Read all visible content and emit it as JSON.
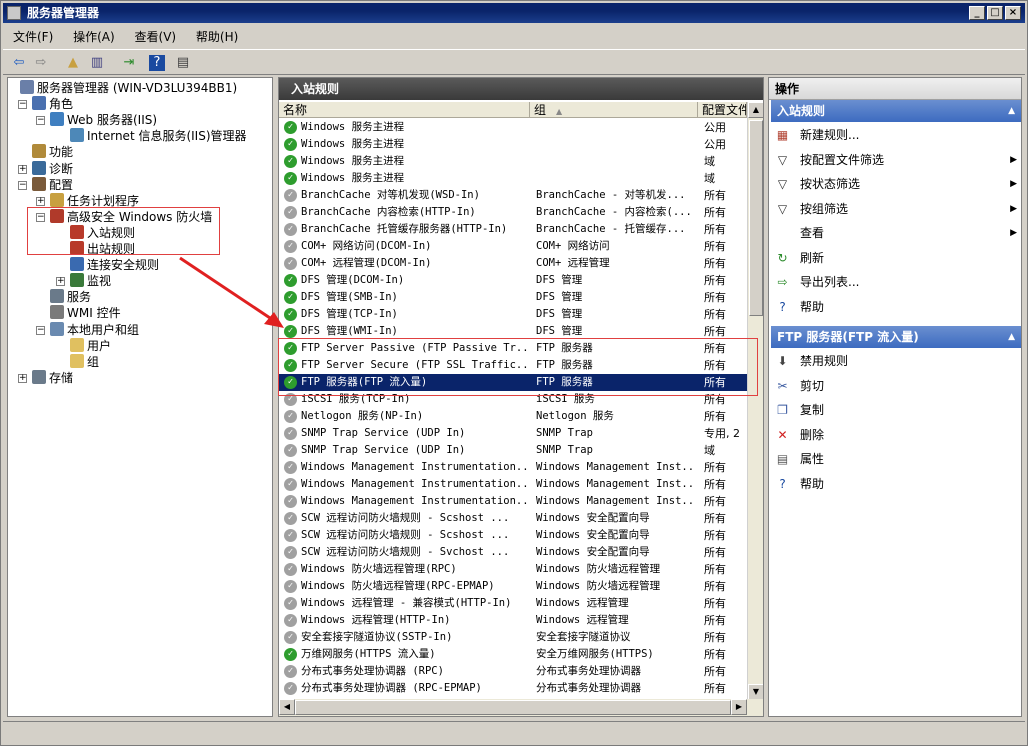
{
  "window": {
    "title": "服务器管理器"
  },
  "menu": [
    "文件(F)",
    "操作(A)",
    "查看(V)",
    "帮助(H)"
  ],
  "tree": [
    {
      "label": "服务器管理器 (WIN-VD3LU394BB1)",
      "level": 0,
      "expander": "",
      "color": "#6a7fa8"
    },
    {
      "label": "角色",
      "level": 1,
      "expander": "−",
      "color": "#4a70b0"
    },
    {
      "label": "Web 服务器(IIS)",
      "level": 2,
      "expander": "−",
      "color": "#3f7fc0"
    },
    {
      "label": "Internet 信息服务(IIS)管理器",
      "level": 3,
      "expander": "",
      "color": "#4d88b8"
    },
    {
      "label": "功能",
      "level": 1,
      "expander": "",
      "color": "#b08a3a"
    },
    {
      "label": "诊断",
      "level": 1,
      "expander": "+",
      "color": "#3a6a9a"
    },
    {
      "label": "配置",
      "level": 1,
      "expander": "−",
      "color": "#7a5a3a"
    },
    {
      "label": "任务计划程序",
      "level": 2,
      "expander": "+",
      "color": "#c8a040"
    },
    {
      "label": "高级安全 Windows 防火墙",
      "level": 2,
      "expander": "−",
      "color": "#b03a2a"
    },
    {
      "label": "入站规则",
      "level": 3,
      "expander": "",
      "color": "#b83a2a"
    },
    {
      "label": "出站规则",
      "level": 3,
      "expander": "",
      "color": "#b83a2a"
    },
    {
      "label": "连接安全规则",
      "level": 3,
      "expander": "",
      "color": "#3a6ab0"
    },
    {
      "label": "监视",
      "level": 3,
      "expander": "+",
      "color": "#3a7a3a"
    },
    {
      "label": "服务",
      "level": 2,
      "expander": "",
      "color": "#6a7a8a"
    },
    {
      "label": "WMI 控件",
      "level": 2,
      "expander": "",
      "color": "#7a7a7a"
    },
    {
      "label": "本地用户和组",
      "level": 2,
      "expander": "−",
      "color": "#6a8ab0"
    },
    {
      "label": "用户",
      "level": 3,
      "expander": "",
      "color": "#e0c060"
    },
    {
      "label": "组",
      "level": 3,
      "expander": "",
      "color": "#e0c060"
    },
    {
      "label": "存储",
      "level": 1,
      "expander": "+",
      "color": "#6a7a8a"
    }
  ],
  "center": {
    "title": "入站规则",
    "columns": [
      "名称",
      "组",
      "配置文件"
    ],
    "sort_indicator": "▲",
    "rows": [
      {
        "name": "Windows 服务主进程",
        "group": "",
        "profile": "公用",
        "enabled": true
      },
      {
        "name": "Windows 服务主进程",
        "group": "",
        "profile": "公用",
        "enabled": true
      },
      {
        "name": "Windows 服务主进程",
        "group": "",
        "profile": "域",
        "enabled": true
      },
      {
        "name": "Windows 服务主进程",
        "group": "",
        "profile": "域",
        "enabled": true
      },
      {
        "name": "BranchCache 对等机发现(WSD-In)",
        "group": "BranchCache - 对等机发...",
        "profile": "所有",
        "enabled": false
      },
      {
        "name": "BranchCache 内容检索(HTTP-In)",
        "group": "BranchCache - 内容检索(...",
        "profile": "所有",
        "enabled": false
      },
      {
        "name": "BranchCache 托管缓存服务器(HTTP-In)",
        "group": "BranchCache - 托管缓存...",
        "profile": "所有",
        "enabled": false
      },
      {
        "name": "COM+ 网络访问(DCOM-In)",
        "group": "COM+ 网络访问",
        "profile": "所有",
        "enabled": false
      },
      {
        "name": "COM+ 远程管理(DCOM-In)",
        "group": "COM+ 远程管理",
        "profile": "所有",
        "enabled": false
      },
      {
        "name": "DFS 管理(DCOM-In)",
        "group": "DFS 管理",
        "profile": "所有",
        "enabled": true
      },
      {
        "name": "DFS 管理(SMB-In)",
        "group": "DFS 管理",
        "profile": "所有",
        "enabled": true
      },
      {
        "name": "DFS 管理(TCP-In)",
        "group": "DFS 管理",
        "profile": "所有",
        "enabled": true
      },
      {
        "name": "DFS 管理(WMI-In)",
        "group": "DFS 管理",
        "profile": "所有",
        "enabled": true
      },
      {
        "name": "FTP Server Passive (FTP Passive Tr...",
        "group": "FTP 服务器",
        "profile": "所有",
        "enabled": true
      },
      {
        "name": "FTP Server Secure (FTP SSL Traffic...",
        "group": "FTP 服务器",
        "profile": "所有",
        "enabled": true
      },
      {
        "name": "FTP 服务器(FTP 流入量)",
        "group": "FTP 服务器",
        "profile": "所有",
        "enabled": true,
        "selected": true
      },
      {
        "name": "iSCSI 服务(TCP-In)",
        "group": "iSCSI 服务",
        "profile": "所有",
        "enabled": false
      },
      {
        "name": "Netlogon 服务(NP-In)",
        "group": "Netlogon 服务",
        "profile": "所有",
        "enabled": false
      },
      {
        "name": "SNMP Trap Service (UDP In)",
        "group": "SNMP Trap",
        "profile": "专用, 2",
        "enabled": false
      },
      {
        "name": "SNMP Trap Service (UDP In)",
        "group": "SNMP Trap",
        "profile": "域",
        "enabled": false
      },
      {
        "name": "Windows Management Instrumentation...",
        "group": "Windows Management Inst...",
        "profile": "所有",
        "enabled": false
      },
      {
        "name": "Windows Management Instrumentation...",
        "group": "Windows Management Inst...",
        "profile": "所有",
        "enabled": false
      },
      {
        "name": "Windows Management Instrumentation...",
        "group": "Windows Management Inst...",
        "profile": "所有",
        "enabled": false
      },
      {
        "name": "SCW 远程访问防火墙规则 - Scshost ...",
        "group": "Windows 安全配置向导",
        "profile": "所有",
        "enabled": false
      },
      {
        "name": "SCW 远程访问防火墙规则 - Scshost ...",
        "group": "Windows 安全配置向导",
        "profile": "所有",
        "enabled": false
      },
      {
        "name": "SCW 远程访问防火墙规则 - Svchost ...",
        "group": "Windows 安全配置向导",
        "profile": "所有",
        "enabled": false
      },
      {
        "name": "Windows 防火墙远程管理(RPC)",
        "group": "Windows 防火墙远程管理",
        "profile": "所有",
        "enabled": false
      },
      {
        "name": "Windows 防火墙远程管理(RPC-EPMAP)",
        "group": "Windows 防火墙远程管理",
        "profile": "所有",
        "enabled": false
      },
      {
        "name": "Windows 远程管理 - 兼容模式(HTTP-In)",
        "group": "Windows 远程管理",
        "profile": "所有",
        "enabled": false
      },
      {
        "name": "Windows 远程管理(HTTP-In)",
        "group": "Windows 远程管理",
        "profile": "所有",
        "enabled": false
      },
      {
        "name": "安全套接字隧道协议(SSTP-In)",
        "group": "安全套接字隧道协议",
        "profile": "所有",
        "enabled": false
      },
      {
        "name": "万维网服务(HTTPS 流入量)",
        "group": "安全万维网服务(HTTPS)",
        "profile": "所有",
        "enabled": true
      },
      {
        "name": "分布式事务处理协调器 (RPC)",
        "group": "分布式事务处理协调器",
        "profile": "所有",
        "enabled": false
      },
      {
        "name": "分布式事务处理协调器 (RPC-EPMAP)",
        "group": "分布式事务处理协调器",
        "profile": "所有",
        "enabled": false
      }
    ]
  },
  "actions": {
    "title": "操作",
    "section1": {
      "title": "入站规则",
      "items": [
        {
          "label": "新建规则...",
          "icon": "new-rule-icon",
          "glyph": "▦",
          "color": "#b04030",
          "submenu": false
        },
        {
          "label": "按配置文件筛选",
          "icon": "filter-icon",
          "glyph": "▽",
          "color": "#333333",
          "submenu": true
        },
        {
          "label": "按状态筛选",
          "icon": "filter-icon",
          "glyph": "▽",
          "color": "#333333",
          "submenu": true
        },
        {
          "label": "按组筛选",
          "icon": "filter-icon",
          "glyph": "▽",
          "color": "#333333",
          "submenu": true
        },
        {
          "label": "查看",
          "icon": "",
          "glyph": "",
          "color": "#333333",
          "submenu": true
        },
        {
          "label": "刷新",
          "icon": "refresh-icon",
          "glyph": "↻",
          "color": "#2a8a2a",
          "submenu": false
        },
        {
          "label": "导出列表...",
          "icon": "export-icon",
          "glyph": "⇨",
          "color": "#2a8a2a",
          "submenu": false
        },
        {
          "label": "帮助",
          "icon": "help-icon",
          "glyph": "?",
          "color": "#1a4aa0",
          "submenu": false
        }
      ]
    },
    "section2": {
      "title": "FTP 服务器(FTP 流入量)",
      "items": [
        {
          "label": "禁用规则",
          "icon": "disable-rule-icon",
          "glyph": "⬇",
          "color": "#444444"
        },
        {
          "label": "剪切",
          "icon": "cut-icon",
          "glyph": "✂",
          "color": "#3a5aa0"
        },
        {
          "label": "复制",
          "icon": "copy-icon",
          "glyph": "❐",
          "color": "#3a5aa0"
        },
        {
          "label": "删除",
          "icon": "delete-icon",
          "glyph": "✕",
          "color": "#d02020"
        },
        {
          "label": "属性",
          "icon": "properties-icon",
          "glyph": "▤",
          "color": "#555555"
        },
        {
          "label": "帮助",
          "icon": "help-icon",
          "glyph": "?",
          "color": "#1a4aa0"
        }
      ]
    }
  }
}
